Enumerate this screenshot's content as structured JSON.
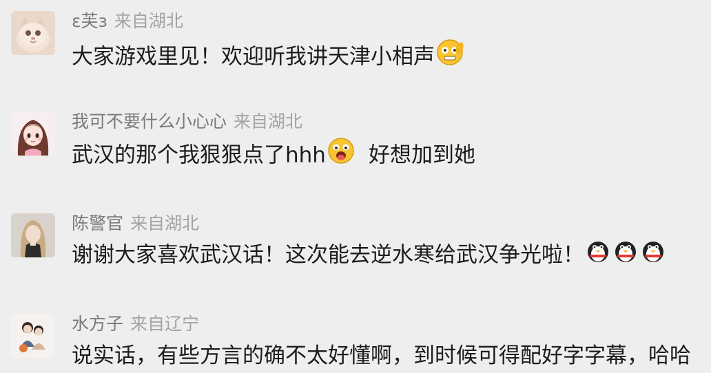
{
  "comments": [
    {
      "username": "ε芙з",
      "location": "来自湖北",
      "text": "大家游戏里见！欢迎听我讲天津小相声",
      "trailing_icons": [
        "grimace-emoji"
      ]
    },
    {
      "username": "我可不要什么小心心",
      "location": "来自湖北",
      "text_before": "武汉的那个我狠狠点了hhh",
      "inline_icon": "tongue-out-emoji",
      "text_after": "好想加到她"
    },
    {
      "username": "陈警官",
      "location": "来自湖北",
      "text": "谢谢大家喜欢武汉话！这次能去逆水寒给武汉争光啦！",
      "trailing_icons": [
        "penguin-emoji",
        "penguin-emoji",
        "penguin-emoji"
      ]
    },
    {
      "username": "水方子",
      "location": "来自辽宁",
      "text": "说实话，有些方言的确不太好懂啊，到时候可得配好字字幕，哈哈"
    }
  ],
  "colors": {
    "background": "#eeeeee",
    "username": "#7a7a7a",
    "location": "#a3a3a3",
    "text": "#1c1c1c"
  }
}
